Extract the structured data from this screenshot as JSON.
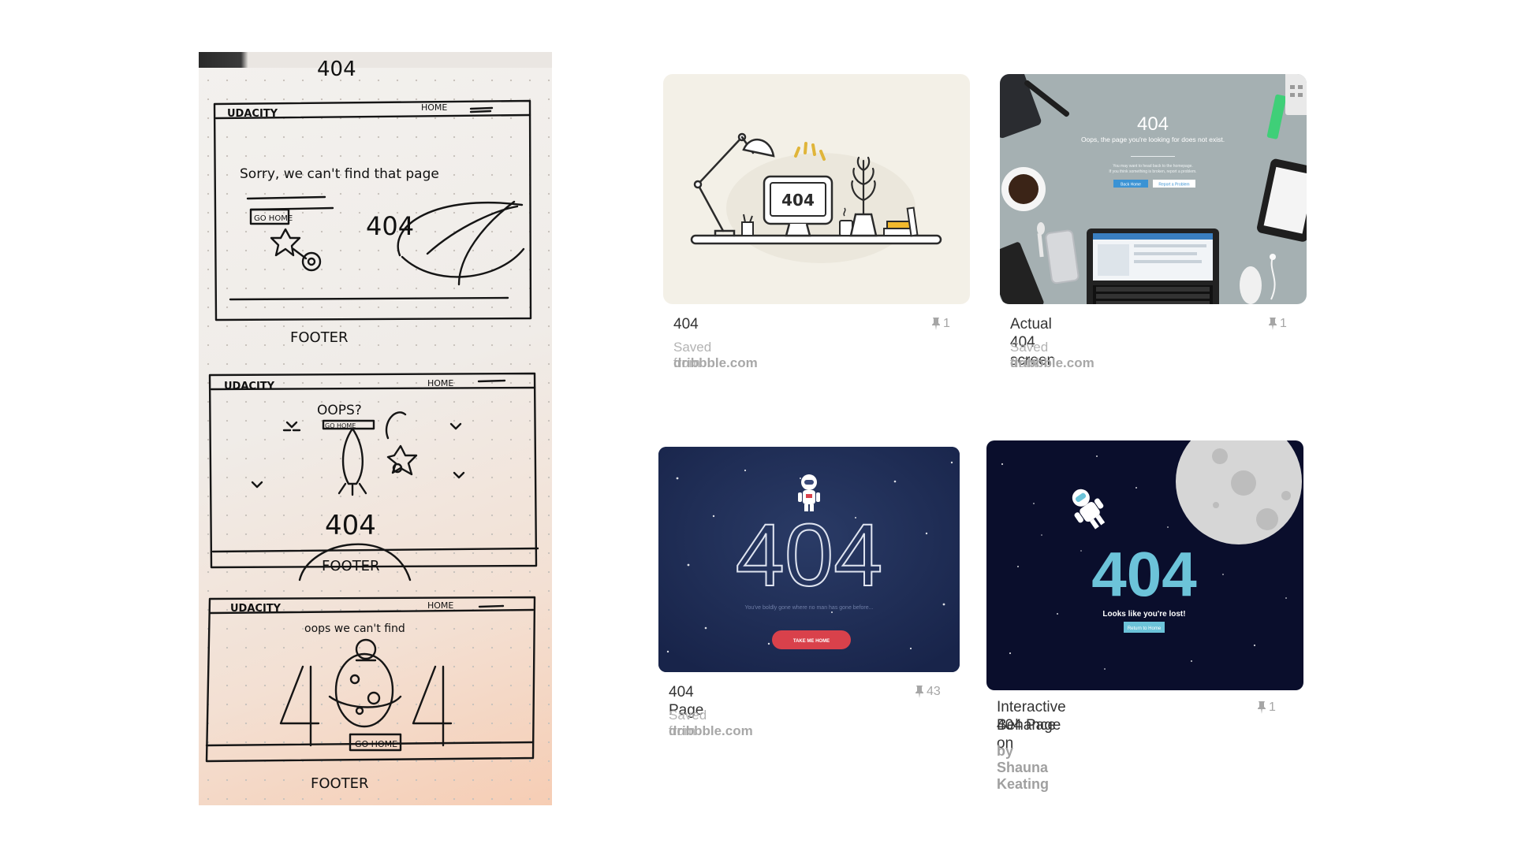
{
  "sketch": {
    "title": "404",
    "frames": [
      {
        "logo": "UDACITY",
        "nav": "HOME",
        "headline": "Sorry, we can't find that page",
        "button": "GO HOME",
        "code": "404",
        "footer": "FOOTER"
      },
      {
        "logo": "UDACITY",
        "nav": "HOME",
        "headline": "OOPS?",
        "button": "GO HOME",
        "code": "404",
        "footer": "FOOTER"
      },
      {
        "logo": "UDACITY",
        "nav": "HOME",
        "headline": "oops we can't find",
        "button": "GO HOME",
        "code": "404",
        "footer": "FOOTER"
      }
    ]
  },
  "pins": [
    {
      "title": "404",
      "count": "1",
      "saved_label": "Saved from",
      "source": "dribbble.com",
      "thumb": {
        "code": "404"
      }
    },
    {
      "title": "Actual 404 screen",
      "count": "1",
      "saved_label": "Saved from",
      "source": "dribbble.com",
      "thumb": {
        "code": "404",
        "message": "Oops, the page you're looking for does not exist.",
        "sub_line1": "You may want to head back to the homepage.",
        "sub_line2": "If you think something is broken, report a problem.",
        "btn_home": "Back Home",
        "btn_report": "Report a Problem"
      }
    },
    {
      "title": "404 Page",
      "count": "43",
      "saved_label": "Saved from",
      "source": "dribbble.com",
      "thumb": {
        "code": "404",
        "message": "You've boldly gone where no man has gone before...",
        "button": "TAKE ME HOME"
      }
    },
    {
      "title_line1": "Interactive 404 Page on",
      "title_line2": "Behance",
      "count": "1",
      "byline": "by Shauna Keating",
      "thumb": {
        "code": "404",
        "message": "Looks like you're lost!",
        "button": "Return to Home"
      }
    }
  ],
  "colors": {
    "card1_bg": "#f3f0e7",
    "card2_bg": "#a5b0b2",
    "card3_bg": "#1d2b4f",
    "card4_bg": "#0a0e2c",
    "accent_red": "#d9414b",
    "accent_teal": "#6cc3d9"
  }
}
